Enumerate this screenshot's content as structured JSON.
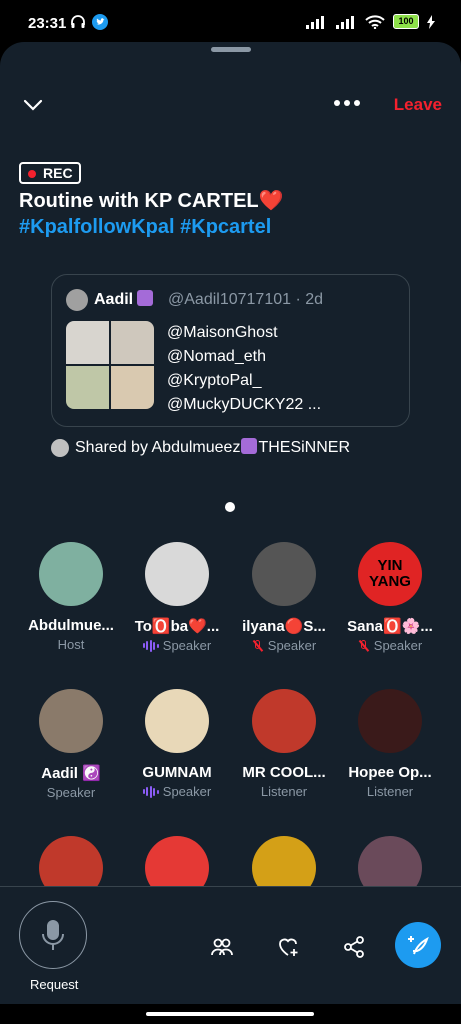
{
  "status": {
    "time": "23:31",
    "battery": "100"
  },
  "header": {
    "leave_label": "Leave"
  },
  "space": {
    "rec_label": "REC",
    "title": "Routine with KP CARTEL❤️",
    "hashtags": "#KpalfollowKpal #Kpcartel"
  },
  "tweet": {
    "name": "Aadil",
    "handle": "@Aadil10717101 · 2d",
    "lines": [
      "@MaisonGhost",
      "@Nomad_eth",
      "@KryptoPal_",
      "@MuckyDUCKY22 ..."
    ]
  },
  "shared": {
    "prefix": "Shared by Abdulmueez",
    "suffix": "THESiNNER"
  },
  "participants": [
    {
      "name": "Abdulmue...",
      "role": "Host",
      "indicator": "none",
      "avatar_color": "#7fb0a0"
    },
    {
      "name": "To🅾️ba❤️...",
      "role": "Speaker",
      "indicator": "speaking",
      "avatar_color": "#d9d9d9"
    },
    {
      "name": "ilyana🔴S...",
      "role": "Speaker",
      "indicator": "muted",
      "avatar_color": "#555555"
    },
    {
      "name": "Sana🅾️🌸...",
      "role": "Speaker",
      "indicator": "muted",
      "avatar_color": "#e02424",
      "avatar_text": "YIN YANG"
    },
    {
      "name": "Aadil ☯️",
      "role": "Speaker",
      "indicator": "none",
      "avatar_color": "#8a7a6a"
    },
    {
      "name": "GUMNAM",
      "role": "Speaker",
      "indicator": "speaking",
      "avatar_color": "#e8d8b8"
    },
    {
      "name": "MR COOL...",
      "role": "Listener",
      "indicator": "none",
      "avatar_color": "#c0392b"
    },
    {
      "name": "Hopee Op...",
      "role": "Listener",
      "indicator": "none",
      "avatar_color": "#3a1a1a"
    },
    {
      "name": "",
      "role": "",
      "indicator": "none",
      "avatar_color": "#c0392b"
    },
    {
      "name": "",
      "role": "",
      "indicator": "none",
      "avatar_color": "#e53935"
    },
    {
      "name": "",
      "role": "",
      "indicator": "none",
      "avatar_color": "#d4a017"
    },
    {
      "name": "",
      "role": "",
      "indicator": "none",
      "avatar_color": "#6a4a5a"
    }
  ],
  "bottom": {
    "request_label": "Request"
  },
  "colors": {
    "accent": "#1d9bf0",
    "leave": "#f4212e",
    "background": "#15202b",
    "speaking": "#8b5cf6"
  }
}
